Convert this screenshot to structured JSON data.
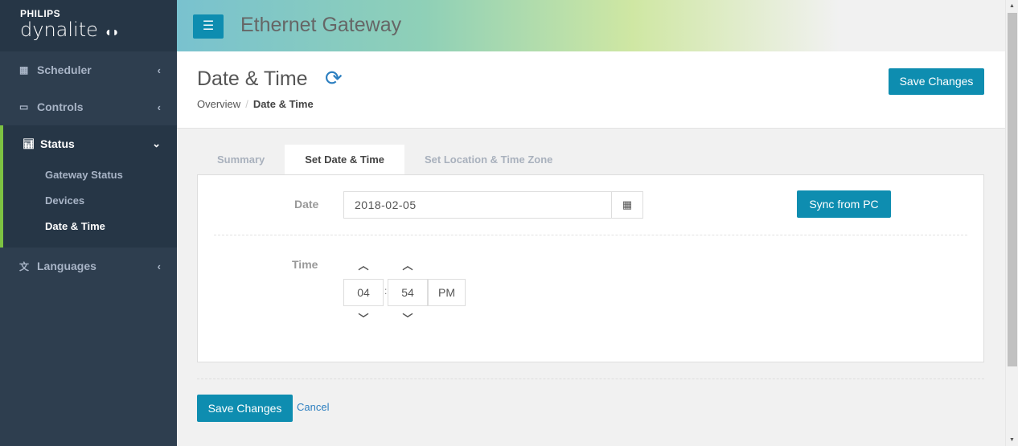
{
  "brand": {
    "line1": "PHILIPS",
    "line2": "dynalite"
  },
  "app_title": "Ethernet Gateway",
  "sidebar": {
    "items": [
      {
        "label": "Scheduler",
        "icon": "table-icon"
      },
      {
        "label": "Controls",
        "icon": "monitor-icon"
      },
      {
        "label": "Status",
        "icon": "bar-chart-icon",
        "expanded": true,
        "children": [
          "Gateway Status",
          "Devices",
          "Date & Time"
        ],
        "active_child": "Date & Time"
      },
      {
        "label": "Languages",
        "icon": "language-icon"
      }
    ]
  },
  "page": {
    "title": "Date & Time",
    "breadcrumb": [
      "Overview",
      "Date & Time"
    ],
    "save_label": "Save Changes"
  },
  "tabs": [
    "Summary",
    "Set Date & Time",
    "Set Location & Time Zone"
  ],
  "active_tab": "Set Date & Time",
  "form": {
    "date_label": "Date",
    "date_value": "2018-02-05",
    "sync_label": "Sync from PC",
    "time_label": "Time",
    "hour": "04",
    "minute": "54",
    "separator": ":",
    "meridian": "PM"
  },
  "footer": {
    "save_label": "Save Changes",
    "cancel_label": "Cancel"
  },
  "colors": {
    "accent": "#0e8db0",
    "active_bar": "#7dc242",
    "sidebar": "#2e3e4f"
  }
}
